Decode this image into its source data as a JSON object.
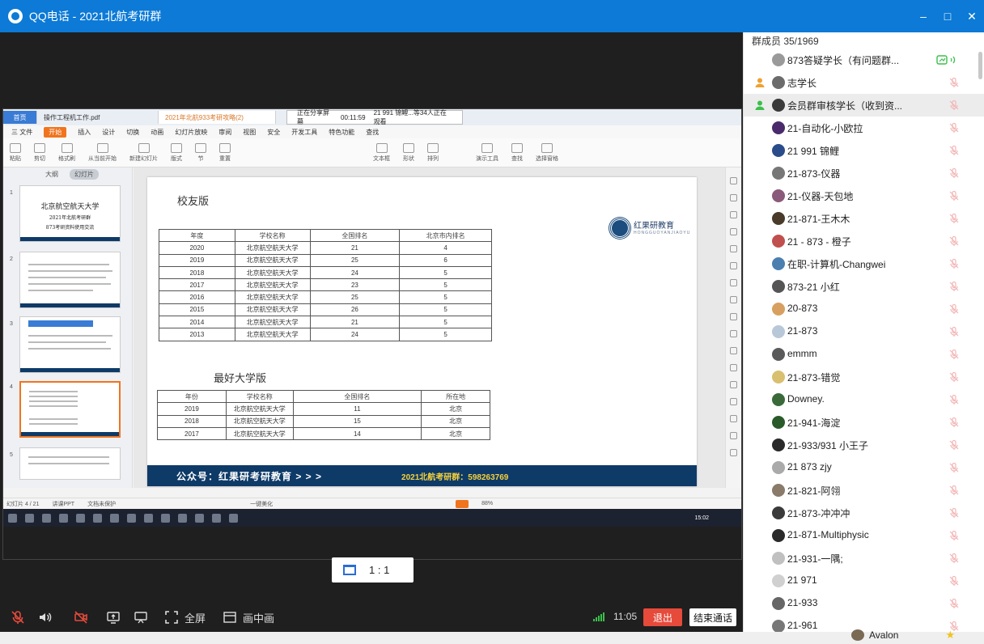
{
  "window": {
    "title": "QQ电话 - 2021北航考研群",
    "controls": [
      "–",
      "□",
      "✕"
    ]
  },
  "shared_screen": {
    "tabs": [
      "首页",
      "操作工程机工作.pdf",
      "2021年北航933考研攻略(2)"
    ],
    "share_banner": {
      "label": "正在分享屏幕",
      "time": "00:11:59",
      "viewers": "21 991 锦鲤...等34人正在观看"
    },
    "menu": [
      "三 文件",
      "开始",
      "插入",
      "设计",
      "切换",
      "动画",
      "幻灯片放映",
      "审阅",
      "视图",
      "安全",
      "开发工具",
      "特色功能",
      "查找"
    ],
    "ribbon": [
      "粘贴",
      "剪切",
      "格式刷",
      "从当前开始",
      "新建幻灯片",
      "版式",
      "节",
      "重置",
      "文本框",
      "形状",
      "排列",
      "演示工具",
      "查找",
      "选择窗格"
    ],
    "thumb_tabs": [
      "大纲",
      "幻灯片"
    ],
    "thumbs": [
      {
        "num": "1",
        "title": "北京航空航天大学",
        "subtitle": "2021年北航考研群",
        "line3": "873考研资料使用交流"
      },
      {
        "num": "2"
      },
      {
        "num": "3"
      },
      {
        "num": "4"
      },
      {
        "num": "5"
      }
    ],
    "slide": {
      "heading1": "校友版",
      "brand": {
        "name": "红果研教育",
        "sub": "HONGGUOYANJIAOYU"
      },
      "table1": {
        "headers": [
          "年度",
          "学校名称",
          "全国排名",
          "北京市内排名"
        ],
        "rows": [
          [
            "2020",
            "北京航空航天大学",
            "21",
            "4"
          ],
          [
            "2019",
            "北京航空航天大学",
            "25",
            "6"
          ],
          [
            "2018",
            "北京航空航天大学",
            "24",
            "5"
          ],
          [
            "2017",
            "北京航空航天大学",
            "23",
            "5"
          ],
          [
            "2016",
            "北京航空航天大学",
            "25",
            "5"
          ],
          [
            "2015",
            "北京航空航天大学",
            "26",
            "5"
          ],
          [
            "2014",
            "北京航空航天大学",
            "21",
            "5"
          ],
          [
            "2013",
            "北京航空航天大学",
            "24",
            "5"
          ]
        ]
      },
      "heading2": "最好大学版",
      "table2": {
        "headers": [
          "年份",
          "学校名称",
          "全国排名",
          "所在地"
        ],
        "rows": [
          [
            "2019",
            "北京航空航天大学",
            "11",
            "北京"
          ],
          [
            "2018",
            "北京航空航天大学",
            "15",
            "北京"
          ],
          [
            "2017",
            "北京航空航天大学",
            "14",
            "北京"
          ]
        ]
      },
      "footer_left": "公众号：红果研考研教育  > > >",
      "footer_right": "2021北航考研群：598263769"
    },
    "status": {
      "slide_count": "幻灯片 4 / 21",
      "theme": "讲课PPT",
      "protect": "文档未保护",
      "beautify": "一键美化",
      "zoom": "88%"
    },
    "taskbar_time": "15:02"
  },
  "ratio_button": "1 : 1",
  "toolbar": {
    "fullscreen": "全屏",
    "pip": "画中画",
    "timer": "11:05",
    "exit": "退出",
    "end_call": "结束通话"
  },
  "members": {
    "header": "群成员 35/1969",
    "list": [
      {
        "name": "873答疑学长（有问题群...",
        "role": "none",
        "state": "speaking",
        "avatar": "#9a9a9a"
      },
      {
        "name": "志学长",
        "role": "owner",
        "state": "muted",
        "avatar": "#6b6b6b"
      },
      {
        "name": "会员群审核学长（收到资...",
        "role": "admin",
        "state": "muted",
        "avatar": "#3a3a3a"
      },
      {
        "name": "21-自动化-小欧拉",
        "role": "none",
        "state": "muted",
        "avatar": "#4b2a6b"
      },
      {
        "name": "21 991 锦鲤",
        "role": "none",
        "state": "muted",
        "avatar": "#2a4c8a"
      },
      {
        "name": "21-873-仪器",
        "role": "none",
        "state": "muted",
        "avatar": "#777777"
      },
      {
        "name": "21-仪器-天包地",
        "role": "none",
        "state": "muted",
        "avatar": "#8a5a7a"
      },
      {
        "name": "21-871-王木木",
        "role": "none",
        "state": "muted",
        "avatar": "#4a3a2a"
      },
      {
        "name": "21 - 873 - 橙子",
        "role": "none",
        "state": "muted",
        "avatar": "#c0504d"
      },
      {
        "name": "在职-计算机-Changwei",
        "role": "none",
        "state": "muted",
        "avatar": "#4b7fb0"
      },
      {
        "name": "873-21 小红",
        "role": "none",
        "state": "muted",
        "avatar": "#555555"
      },
      {
        "name": "20-873",
        "role": "none",
        "state": "muted",
        "avatar": "#d8a060"
      },
      {
        "name": "21-873",
        "role": "none",
        "state": "muted",
        "avatar": "#b8c8d8"
      },
      {
        "name": "emmm",
        "role": "none",
        "state": "muted",
        "avatar": "#5a5a5a"
      },
      {
        "name": "21-873-错觉",
        "role": "none",
        "state": "muted",
        "avatar": "#d8c070"
      },
      {
        "name": "Downey.",
        "role": "none",
        "state": "muted",
        "avatar": "#3a6a3a"
      },
      {
        "name": "21-941-海淀",
        "role": "none",
        "state": "muted",
        "avatar": "#2a5a2a"
      },
      {
        "name": "21-933/931 小王子",
        "role": "none",
        "state": "muted",
        "avatar": "#2a2a2a"
      },
      {
        "name": "21 873 zjy",
        "role": "none",
        "state": "muted",
        "avatar": "#aaaaaa"
      },
      {
        "name": "21-821-阿翎",
        "role": "none",
        "state": "muted",
        "avatar": "#8a7a6a"
      },
      {
        "name": "21-873-冲冲冲",
        "role": "none",
        "state": "muted",
        "avatar": "#3a3a3a"
      },
      {
        "name": "21-871-Multiphysic",
        "role": "none",
        "state": "muted",
        "avatar": "#2a2a2a"
      },
      {
        "name": "21-931-一隅;",
        "role": "none",
        "state": "muted",
        "avatar": "#c0c0c0"
      },
      {
        "name": "21  971",
        "role": "none",
        "state": "muted",
        "avatar": "#d0d0d0"
      },
      {
        "name": "21-933",
        "role": "none",
        "state": "muted",
        "avatar": "#666666"
      },
      {
        "name": "21-961",
        "role": "none",
        "state": "muted",
        "avatar": "#777777"
      }
    ],
    "footer_user": "Avalon"
  },
  "colors": {
    "titlebar": "#0c7ad6",
    "exit": "#e64a3b",
    "muted_icon": "#f2b5b5",
    "speaking_icon": "#3bbf4b",
    "slide_footer": "#0e3a68"
  }
}
